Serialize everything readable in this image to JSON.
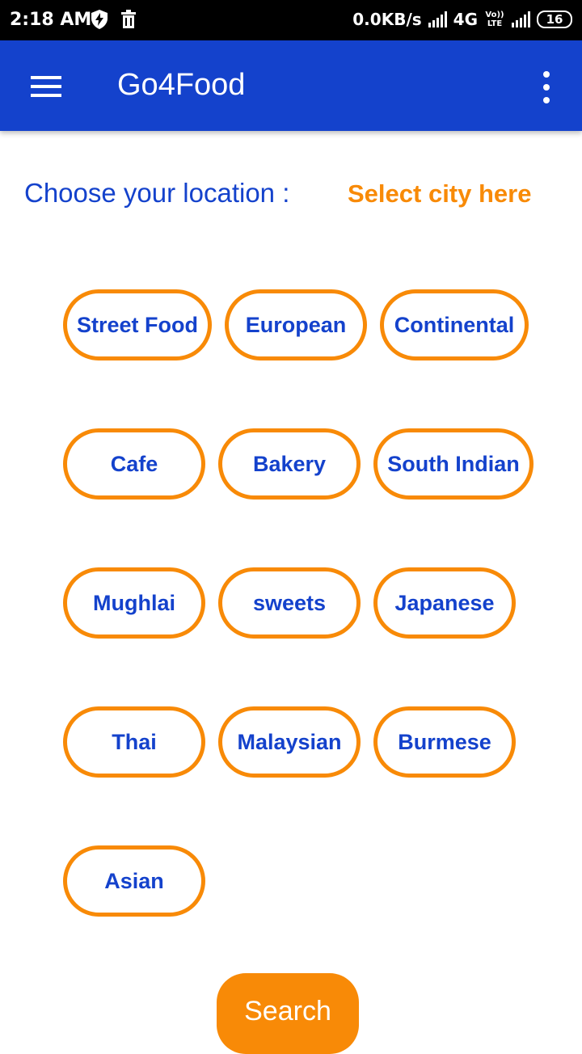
{
  "status_bar": {
    "time": "2:18 AM",
    "network_speed": "0.0KB/s",
    "network_type": "4G",
    "volte": "Vo)) LTE",
    "battery": "16"
  },
  "app_bar": {
    "title": "Go4Food",
    "menu_icon": "hamburger-menu-icon",
    "overflow_icon": "more-vert-icon"
  },
  "location": {
    "label": "Choose your location :",
    "select_text": "Select city here"
  },
  "cuisines": [
    "Street Food",
    "European",
    "Continental",
    "Cafe",
    "Bakery",
    "South Indian",
    "Mughlai",
    "sweets",
    "Japanese",
    "Thai",
    "Malaysian",
    "Burmese",
    "Asian"
  ],
  "search_button": "Search",
  "colors": {
    "primary": "#1442CC",
    "accent": "#F88A07",
    "background": "#FFFFFF"
  }
}
